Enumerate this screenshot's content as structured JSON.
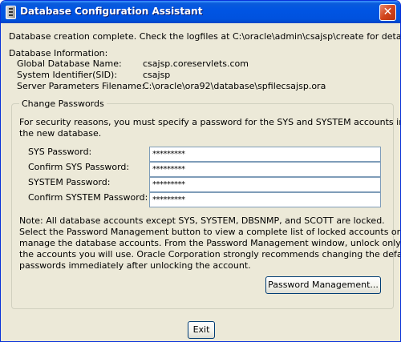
{
  "window": {
    "title": "Database Configuration Assistant",
    "close_glyph": "✕"
  },
  "status_message": "Database creation complete. Check the logfiles at C:\\oracle\\admin\\csajsp\\create for details.",
  "db_info": {
    "heading": "Database Information:",
    "rows": [
      {
        "label": "Global Database Name:",
        "value": "csajsp.coreservlets.com"
      },
      {
        "label": "System Identifier(SID):",
        "value": "csajsp"
      },
      {
        "label": "Server Parameters Filename:",
        "value": "C:\\oracle\\ora92\\database\\spfilecsajsp.ora"
      }
    ]
  },
  "passwords": {
    "legend": "Change Passwords",
    "intro_line1": "For security reasons, you must specify a password for the SYS and SYSTEM accounts in",
    "intro_line2": "the new database.",
    "fields": [
      {
        "label": "SYS Password:",
        "value": "*********"
      },
      {
        "label": "Confirm SYS Password:",
        "value": "*********"
      },
      {
        "label": "SYSTEM Password:",
        "value": "*********"
      },
      {
        "label": "Confirm SYSTEM Password:",
        "value": "*********"
      }
    ],
    "note_lines": [
      "Note: All database accounts except SYS, SYSTEM, DBSNMP, and SCOTT are locked.",
      "Select the Password Management button to view a complete list of locked accounts or to",
      "manage the database accounts. From the Password Management window, unlock only",
      "the accounts you will use. Oracle Corporation strongly recommends changing the default",
      "passwords immediately after unlocking the account."
    ],
    "password_management_label": "Password Management..."
  },
  "exit_label": "Exit"
}
